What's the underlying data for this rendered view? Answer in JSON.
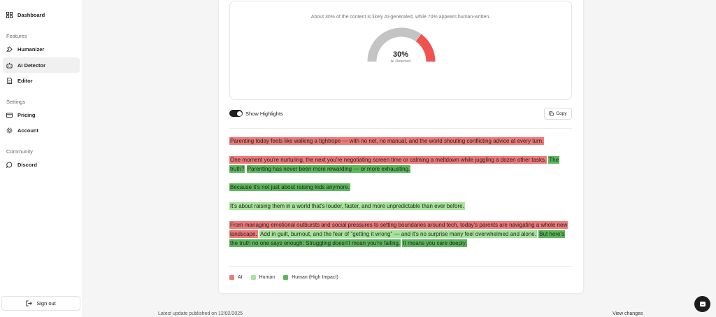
{
  "sidebar": {
    "items": [
      {
        "label": "Dashboard",
        "icon": "dashboard-icon"
      },
      {
        "label": "Humanizer",
        "icon": "humanizer-icon"
      },
      {
        "label": "AI Detector",
        "icon": "bot-icon",
        "active": true
      },
      {
        "label": "Editor",
        "icon": "document-icon"
      },
      {
        "label": "Pricing",
        "icon": "card-icon"
      },
      {
        "label": "Account",
        "icon": "gear-icon"
      },
      {
        "label": "Discord",
        "icon": "chat-bubble-icon"
      }
    ],
    "sections": [
      "Features",
      "Settings",
      "Community"
    ],
    "signout_label": "Sign out"
  },
  "detector": {
    "summary": "About 30% of the content is likely AI-generated, while 70% appears human-written.",
    "gauge": {
      "value_text": "30%",
      "label": "AI Detected",
      "ai_fraction": 0.3,
      "ai_color": "#f05252",
      "human_color": "#c4c4c4"
    },
    "show_highlights_label": "Show Highlights",
    "show_highlights_on": true,
    "copy_label": "Copy"
  },
  "paragraphs": [
    [
      {
        "text": "Parenting today feels like walking a tightrope — with no net, no manual, and the world shouting conflicting advice at every turn.",
        "type": "ai"
      }
    ],
    [
      {
        "text": "One moment you're nurturing, the next you're negotiating screen time or calming a meltdown while juggling a dozen other tasks.",
        "type": "ai"
      },
      {
        "text": "The truth?",
        "type": "high"
      },
      {
        "text": "Parenting has never been more rewarding — or more exhausting.",
        "type": "high"
      }
    ],
    [
      {
        "text": "Because it's not just about raising kids anymore.",
        "type": "high"
      }
    ],
    [
      {
        "text": "It's about raising them in a world that's louder, faster, and more unpredictable than ever before.",
        "type": "human"
      }
    ],
    [
      {
        "text": "From managing emotional outbursts and social pressures to setting boundaries around tech, today's parents are navigating a whole new landscape.",
        "type": "ai"
      },
      {
        "text": "Add in guilt, burnout, and the fear of \"getting it wrong\" — and it's no surprise many feel overwhelmed and alone.",
        "type": "human"
      },
      {
        "text": "But here's the truth no one says enough: Struggling doesn't mean you're failing.",
        "type": "high"
      },
      {
        "text": "It means you care deeply.",
        "type": "high"
      }
    ]
  ],
  "legend": [
    {
      "label": "AI",
      "color": "#ef7a7a"
    },
    {
      "label": "Human",
      "color": "#a6e49b"
    },
    {
      "label": "Human (High Impact)",
      "color": "#5cb85c"
    }
  ],
  "footer": {
    "update_text": "Latest update published on 12/02/2025",
    "view_changes_label": "View changes"
  }
}
